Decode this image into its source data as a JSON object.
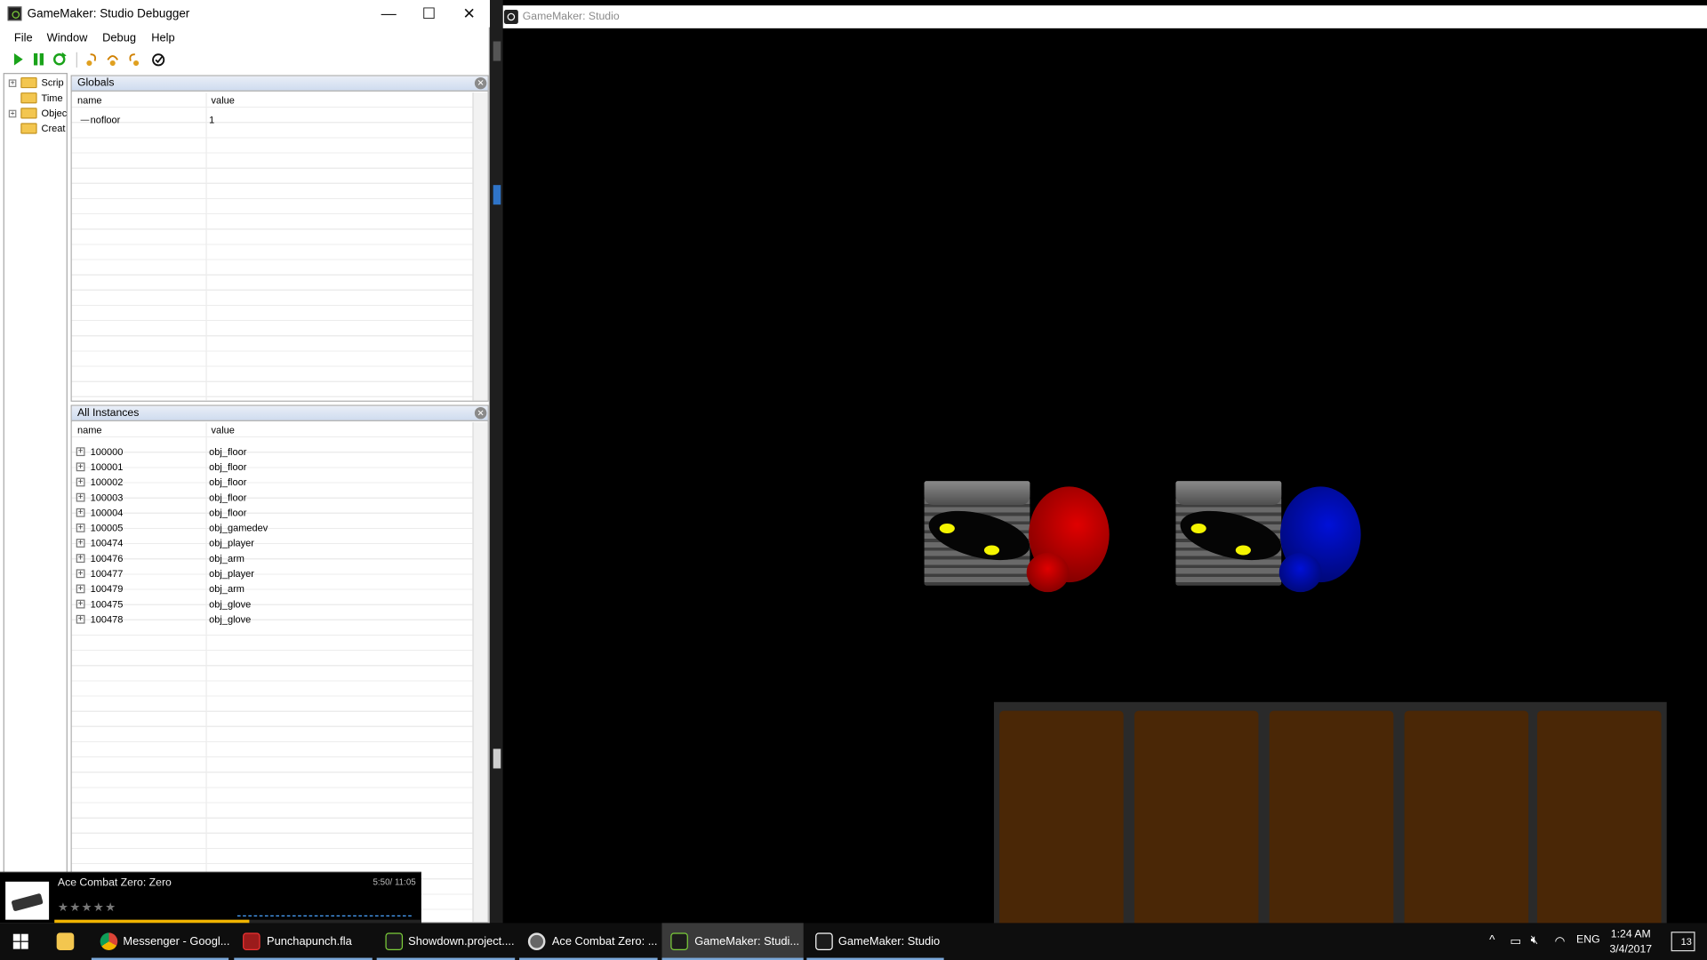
{
  "debugger": {
    "title": "GameMaker: Studio Debugger",
    "window_buttons": {
      "minimize": "—",
      "maximize": "☐",
      "close": "✕"
    },
    "menu": [
      "File",
      "Window",
      "Debug",
      "Help"
    ],
    "tree": [
      {
        "label": "Scrip",
        "expandable": true
      },
      {
        "label": "Time",
        "expandable": false
      },
      {
        "label": "Objec",
        "expandable": true
      },
      {
        "label": "Creat",
        "expandable": false
      }
    ],
    "globals": {
      "title": "Globals",
      "col_name": "name",
      "col_value": "value",
      "rows": [
        {
          "name": "nofloor",
          "value": "1"
        }
      ]
    },
    "instances": {
      "title": "All Instances",
      "col_name": "name",
      "col_value": "value",
      "rows": [
        {
          "name": "100000",
          "value": "obj_floor"
        },
        {
          "name": "100001",
          "value": "obj_floor"
        },
        {
          "name": "100002",
          "value": "obj_floor"
        },
        {
          "name": "100003",
          "value": "obj_floor"
        },
        {
          "name": "100004",
          "value": "obj_floor"
        },
        {
          "name": "100005",
          "value": "obj_gamedev"
        },
        {
          "name": "100474",
          "value": "obj_player"
        },
        {
          "name": "100476",
          "value": "obj_arm"
        },
        {
          "name": "100477",
          "value": "obj_player"
        },
        {
          "name": "100479",
          "value": "obj_arm"
        },
        {
          "name": "100475",
          "value": "obj_glove"
        },
        {
          "name": "100478",
          "value": "obj_glove"
        }
      ]
    }
  },
  "game": {
    "title": "GameMaker: Studio",
    "player1_color": "#e00000",
    "player2_color": "#0010d8"
  },
  "media_toast": {
    "track": "Ace Combat Zero: Zero",
    "time": "5:50/ 11:05",
    "progress": 0.53,
    "rating_stars": "★★★★★"
  },
  "taskbar": {
    "items": [
      {
        "label": "Messenger - Googl...",
        "active": false
      },
      {
        "label": "Punchapunch.fla",
        "active": false
      },
      {
        "label": "Showdown.project....",
        "active": false
      },
      {
        "label": "Ace Combat Zero: ...",
        "active": false
      },
      {
        "label": "GameMaker: Studi...",
        "active": true
      },
      {
        "label": "GameMaker: Studio",
        "active": false
      }
    ],
    "language": "ENG",
    "time": "1:24 AM",
    "date": "3/4/2017",
    "notifications": "13"
  }
}
